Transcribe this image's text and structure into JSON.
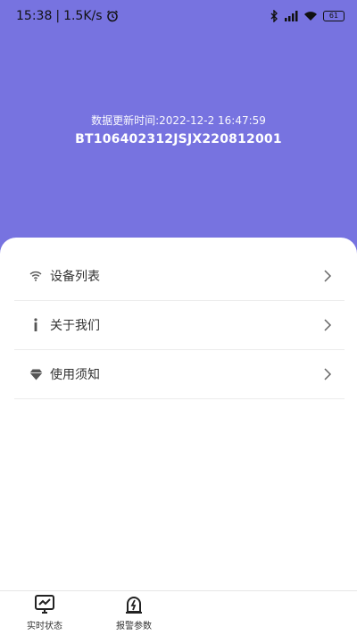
{
  "status_bar": {
    "time": "15:38",
    "speed": "1.5K/s",
    "battery": "61"
  },
  "header": {
    "update_time": "数据更新时间:2022-12-2 16:47:59",
    "device_id": "BT106402312JSJX220812001",
    "color": "#7773e0"
  },
  "menu": [
    {
      "label": "设备列表",
      "icon": "wifi-icon"
    },
    {
      "label": "关于我们",
      "icon": "info-icon"
    },
    {
      "label": "使用须知",
      "icon": "diamond-icon"
    }
  ],
  "tabs": [
    {
      "label": "实时状态",
      "icon": "monitor-chart-icon"
    },
    {
      "label": "报警参数",
      "icon": "alarm-bell-icon"
    }
  ]
}
